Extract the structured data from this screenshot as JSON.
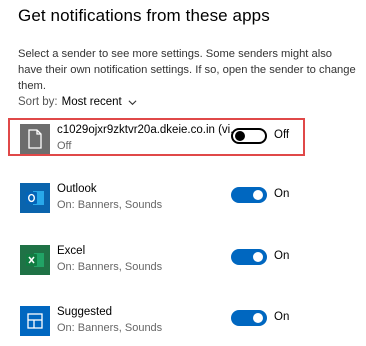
{
  "header": {
    "title": "Get notifications from these apps",
    "description": "Select a sender to see more settings. Some senders might also have their own notification settings. If so, open the sender to change them."
  },
  "sort": {
    "label": "Sort by:",
    "value": "Most recent"
  },
  "apps": [
    {
      "name": "c1029ojxr9zktvr20a.dkeie.co.in (vi...",
      "status": "Off",
      "toggle": "Off",
      "on": false,
      "icon": "generic-file-icon"
    },
    {
      "name": "Outlook",
      "status": "On: Banners, Sounds",
      "toggle": "On",
      "on": true,
      "icon": "outlook-icon"
    },
    {
      "name": "Excel",
      "status": "On: Banners, Sounds",
      "toggle": "On",
      "on": true,
      "icon": "excel-icon"
    },
    {
      "name": "Suggested",
      "status": "On: Banners, Sounds",
      "toggle": "On",
      "on": true,
      "icon": "suggested-icon"
    }
  ],
  "colors": {
    "accent": "#0067c0",
    "highlight": "#e04848",
    "excel": "#1f7246",
    "outlook": "#0a64ad"
  }
}
